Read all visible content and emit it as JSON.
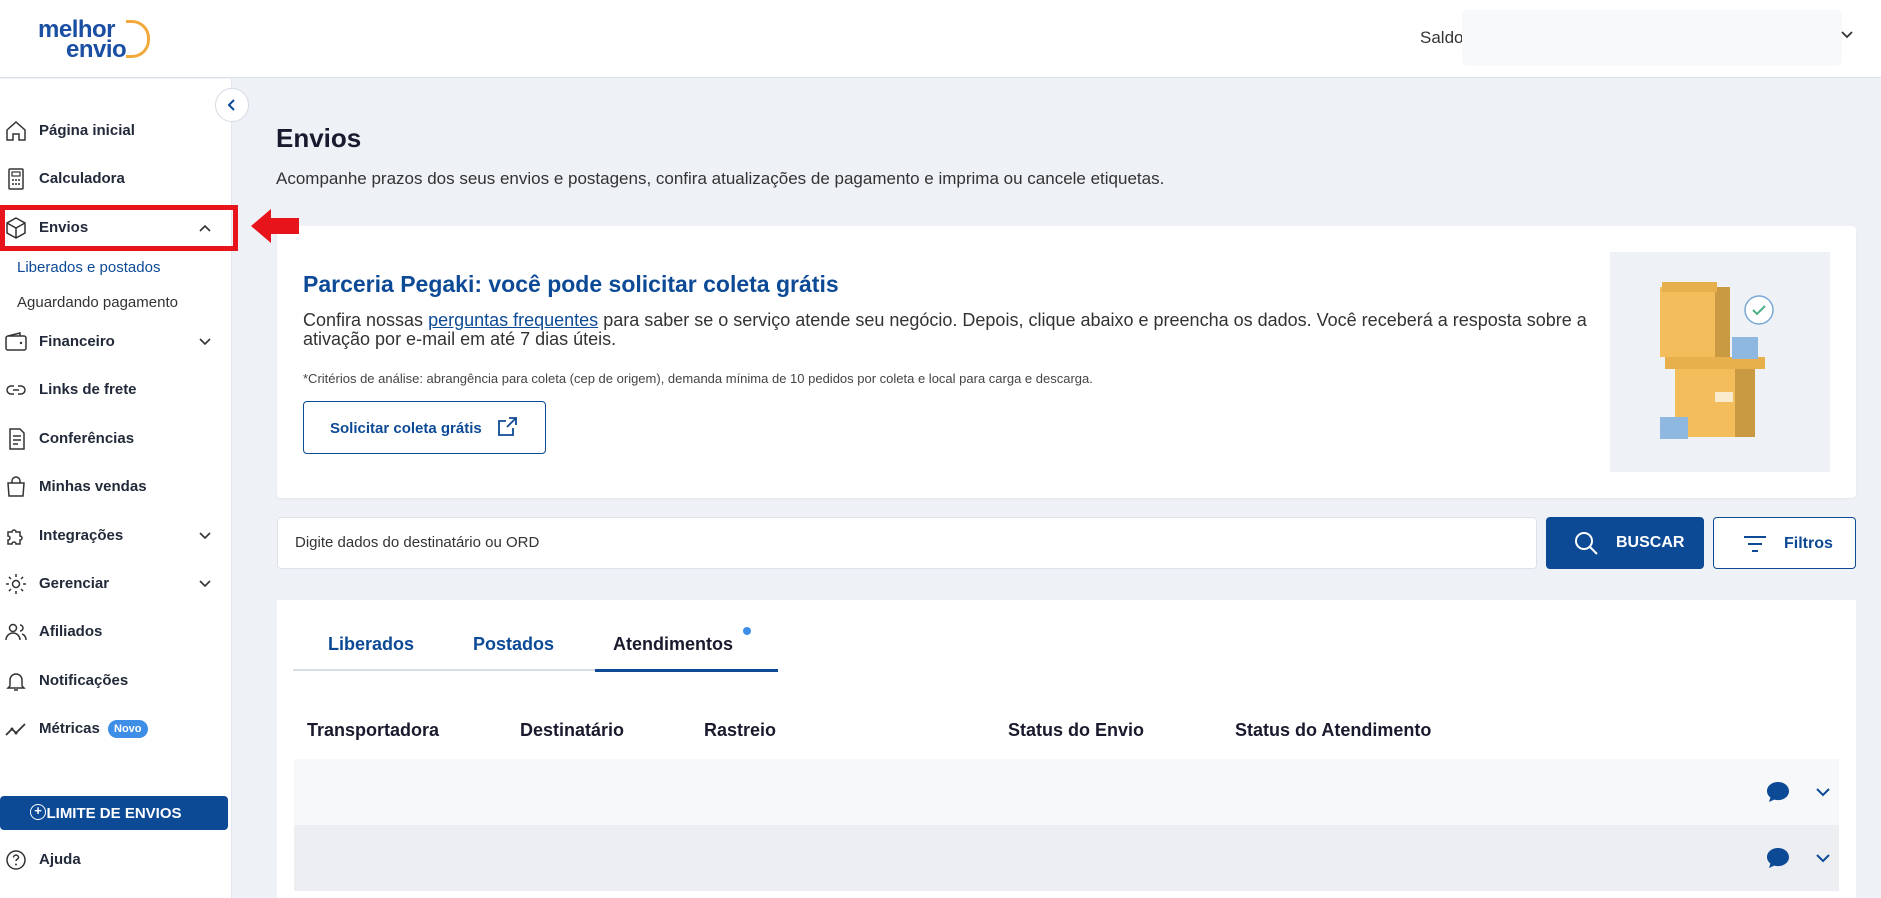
{
  "header": {
    "logo_line1": "melhor",
    "logo_line2": "envio",
    "saldo_label": "Saldo:"
  },
  "sidebar": {
    "items": [
      {
        "label": "Página inicial",
        "icon": "home-icon"
      },
      {
        "label": "Calculadora",
        "icon": "calculator-icon"
      },
      {
        "label": "Envios",
        "icon": "box-icon",
        "expanded": true
      },
      {
        "label": "Financeiro",
        "icon": "wallet-icon"
      },
      {
        "label": "Links de frete",
        "icon": "link-icon"
      },
      {
        "label": "Conferências",
        "icon": "document-icon"
      },
      {
        "label": "Minhas vendas",
        "icon": "shopping-bag-icon"
      },
      {
        "label": "Integrações",
        "icon": "puzzle-icon"
      },
      {
        "label": "Gerenciar",
        "icon": "gear-icon"
      },
      {
        "label": "Afiliados",
        "icon": "users-icon"
      },
      {
        "label": "Notificações",
        "icon": "bell-icon"
      },
      {
        "label": "Métricas",
        "icon": "chart-line-icon",
        "badge": "Novo"
      }
    ],
    "sub_items": [
      "Liberados e postados",
      "Aguardando pagamento"
    ],
    "limit_button": "LIMITE DE ENVIOS",
    "help": "Ajuda"
  },
  "main": {
    "title": "Envios",
    "description": "Acompanhe prazos dos seus envios e postagens, confira atualizações de pagamento e imprima ou cancele etiquetas.",
    "promo": {
      "title": "Parceria Pegaki: você pode solicitar coleta grátis",
      "text_before": "Confira nossas ",
      "link": "perguntas frequentes",
      "text_after": " para saber se o serviço atende seu negócio. Depois, clique abaixo e preencha os dados. Você receberá a resposta sobre a ativação por e-mail em até 7 dias úteis.",
      "note": "*Critérios de análise: abrangência para coleta (cep de origem), demanda mínima de 10 pedidos por coleta e local para carga e descarga.",
      "button": "Solicitar coleta grátis"
    },
    "search": {
      "placeholder": "Digite dados do destinatário ou ORD",
      "buscar": "BUSCAR",
      "filtros": "Filtros"
    },
    "tabs": [
      "Liberados",
      "Postados",
      "Atendimentos"
    ],
    "active_tab": "Atendimentos",
    "columns": [
      "Transportadora",
      "Destinatário",
      "Rastreio",
      "Status do Envio",
      "Status do Atendimento"
    ]
  },
  "colors": {
    "primary": "#0d4a96",
    "accent": "#f2a93b",
    "highlight": "#e8141b",
    "badge": "#3e8ee8"
  }
}
